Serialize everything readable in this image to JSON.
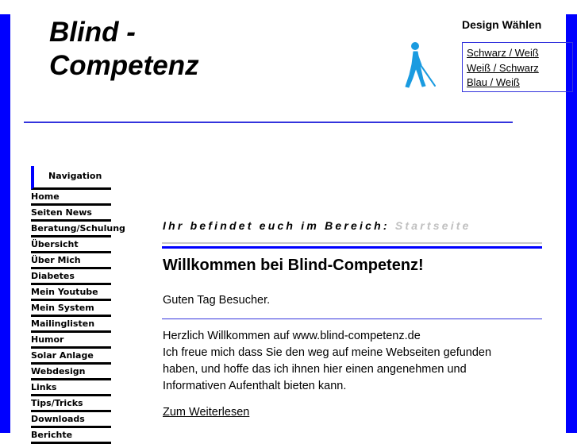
{
  "site": {
    "title_line1": "Blind -",
    "title_line2": "Competenz",
    "logo_icon": "blind-person-with-cane-icon",
    "accent_color": "#0000ff",
    "logo_color": "#1a9be0"
  },
  "design": {
    "title": "Design Wählen",
    "options": [
      {
        "label": "Schwarz / Weiß"
      },
      {
        "label": "Weiß / Schwarz"
      },
      {
        "label": "Blau / Weiß"
      }
    ]
  },
  "nav": {
    "header": "Navigation",
    "items": [
      {
        "label": "Home"
      },
      {
        "label": "Seiten News"
      },
      {
        "label": "Beratung/Schulung"
      },
      {
        "label": "Übersicht"
      },
      {
        "label": "Über Mich"
      },
      {
        "label": "Diabetes"
      },
      {
        "label": "Mein Youtube"
      },
      {
        "label": "Mein System"
      },
      {
        "label": "Mailinglisten"
      },
      {
        "label": "Humor"
      },
      {
        "label": "Solar Anlage"
      },
      {
        "label": "Webdesign"
      },
      {
        "label": "Links"
      },
      {
        "label": "Tips/Tricks"
      },
      {
        "label": "Downloads"
      },
      {
        "label": "Berichte"
      }
    ]
  },
  "main": {
    "breadcrumb_prefix": "Ihr befindet euch im Bereich:",
    "breadcrumb_current": "Startseite",
    "heading": "Willkommen bei Blind-Competenz!",
    "greeting": "Guten Tag Besucher.",
    "intro_lines": [
      "Herzlich Willkommen auf www.blind-competenz.de",
      "Ich freue mich dass Sie den weg auf meine Webseiten gefunden",
      "haben, und hoffe das ich ihnen hier einen angenehmen und",
      "Informativen Aufenthalt bieten kann."
    ],
    "read_more": "Zum Weiterlesen"
  }
}
